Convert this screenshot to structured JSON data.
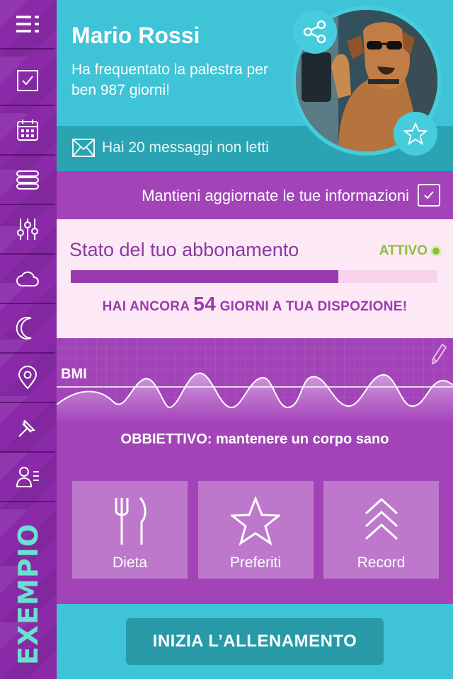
{
  "app": {
    "brand": "EXEMPIO"
  },
  "sidebar": {
    "items": [
      {
        "icon": "hamburger-menu-icon"
      },
      {
        "icon": "checkbox-icon"
      },
      {
        "icon": "calendar-icon"
      },
      {
        "icon": "stack-icon"
      },
      {
        "icon": "sliders-icon"
      },
      {
        "icon": "cloud-icon"
      },
      {
        "icon": "moon-icon"
      },
      {
        "icon": "location-pin-icon"
      },
      {
        "icon": "pushpin-icon"
      },
      {
        "icon": "user-list-icon"
      }
    ]
  },
  "profile": {
    "name": "Mario Rossi",
    "subtitle": "Ha frequentato la palestra per ben 987 giorni!",
    "messages": "Hai 20 messaggi non letti"
  },
  "update": {
    "text": "Mantieni aggiornate le tue informazioni"
  },
  "subscription": {
    "title": "Stato del tuo abbonamento",
    "status": "ATTIVO",
    "progress": 0.73,
    "days_prefix": "HAI ANCORA",
    "days_value": "54",
    "days_suffix": "GIORNI A TUA DISPOZIONE!"
  },
  "bmi": {
    "label": "BMI",
    "goal": "OBBIETTIVO: mantenere un corpo sano"
  },
  "tiles": [
    {
      "label": "Dieta",
      "icon": "fork-knife-icon"
    },
    {
      "label": "Preferiti",
      "icon": "star-icon"
    },
    {
      "label": "Record",
      "icon": "chevrons-up-icon"
    }
  ],
  "cta": {
    "label": "INIZIA L’ALLENAMENTO"
  },
  "colors": {
    "sidebar": "#8a2aa8",
    "accent_cyan": "#3fc3d6",
    "purple": "#a244b8",
    "active_green": "#8abf3a"
  }
}
